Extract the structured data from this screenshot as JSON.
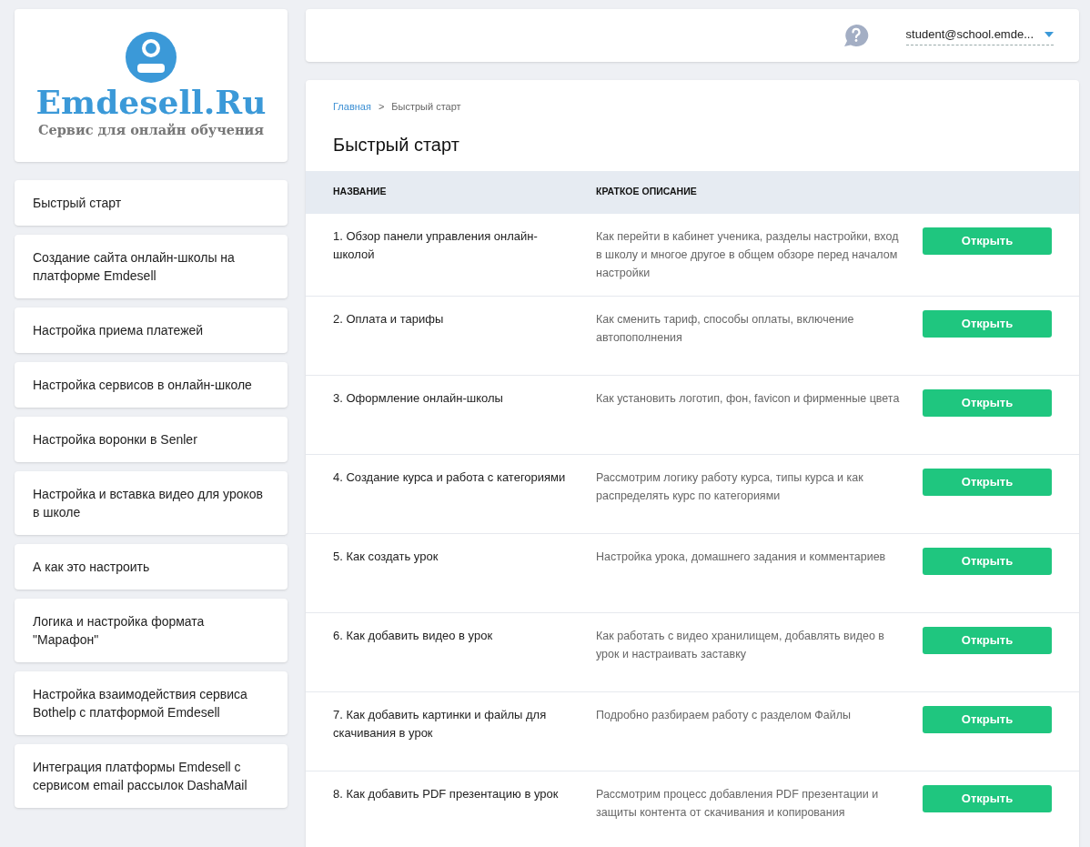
{
  "logo": {
    "title": "Emdesell.Ru",
    "subtitle": "Сервис для онлайн обучения"
  },
  "sidebar": {
    "items": [
      {
        "label": "Быстрый старт"
      },
      {
        "label": "Создание сайта онлайн-школы на платформе Emdesell"
      },
      {
        "label": "Настройка приема платежей"
      },
      {
        "label": "Настройка сервисов в онлайн-школе"
      },
      {
        "label": "Настройка воронки в Senler"
      },
      {
        "label": "Настройка и вставка видео для уроков в школе"
      },
      {
        "label": "А как это настроить"
      },
      {
        "label": "Логика и настройка формата \"Марафон\""
      },
      {
        "label": "Настройка взаимодействия сервиса Bothelp с платформой Emdesell"
      },
      {
        "label": "Интеграция платформы Emdesell с сервисом email рассылок DashaMail"
      }
    ]
  },
  "header": {
    "user": "student@school.emde..."
  },
  "breadcrumbs": [
    {
      "label": "Главная",
      "link": true
    },
    {
      "label": "Быстрый старт",
      "link": false
    }
  ],
  "breadcrumb_separator": ">",
  "page_title": "Быстрый старт",
  "table": {
    "columns": [
      "НАЗВАНИЕ",
      "КРАТКОЕ ОПИСАНИЕ"
    ],
    "rows": [
      {
        "name": "1. Обзор панели управления онлайн-школой",
        "description": "Как перейти в кабинет ученика, разделы настройки, вход в школу и многое другое в общем обзоре перед началом настройки",
        "button": "Открыть"
      },
      {
        "name": "2. Оплата и тарифы",
        "description": "Как сменить тариф, способы оплаты, включение автопополнения",
        "button": "Открыть"
      },
      {
        "name": "3. Оформление онлайн-школы",
        "description": "Как установить логотип, фон, favicon и фирменные цвета",
        "button": "Открыть"
      },
      {
        "name": "4. Создание курса и работа с категориями",
        "description": "Рассмотрим логику работу курса, типы курса и как распределять курс по категориями",
        "button": "Открыть"
      },
      {
        "name": "5. Как создать урок",
        "description": "Настройка урока, домашнего задания и комментариев",
        "button": "Открыть"
      },
      {
        "name": "6. Как добавить видео в урок",
        "description": "Как работать с видео хранилищем, добавлять видео в урок и настраивать заставку",
        "button": "Открыть"
      },
      {
        "name": "7. Как добавить картинки и файлы для скачивания в урок",
        "description": "Подробно разбираем работу с разделом Файлы",
        "button": "Открыть"
      },
      {
        "name": "8. Как добавить PDF презентацию в урок",
        "description": "Рассмотрим процесс добавления PDF презентации и защиты контента от скачивания и копирования",
        "button": "Открыть"
      }
    ]
  }
}
